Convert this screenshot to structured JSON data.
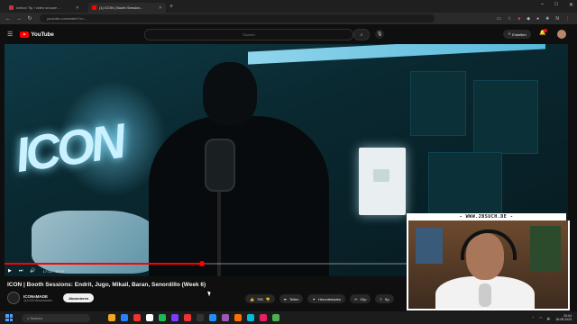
{
  "browser": {
    "tabs": [
      {
        "label": "Icebox Tip / video snooze ...",
        "favicon_color": "#c33"
      },
      {
        "label": "(1) ICON | Booth Session...",
        "favicon_color": "#ff0000"
      }
    ],
    "new_tab": "+",
    "url": "youtube.com/watch?v=...",
    "window_controls": [
      "–",
      "□",
      "✕"
    ]
  },
  "youtube": {
    "logo_text": "YouTube",
    "search_placeholder": "Suchen",
    "create_label": "Erstellen"
  },
  "player": {
    "time": "17:11 / 48:39",
    "progress": 0.35,
    "neon_text": "ICON"
  },
  "video": {
    "title": "ICON | Booth Sessions: Endrit, Jugo, Mikail, Baran, Senordillo (Week 6)",
    "channel_name": "ICONsMADE",
    "subscribers": "114.000 Abonnenten",
    "subscribe_label": "Abonnieren",
    "actions": [
      {
        "icon": "👍",
        "label": "759"
      },
      {
        "icon": "➦",
        "label": "Teilen"
      },
      {
        "icon": "✦",
        "label": "Herunterladen"
      },
      {
        "icon": "✂",
        "label": "Clip"
      },
      {
        "icon": "≡",
        "label": "Sp"
      }
    ]
  },
  "webcam": {
    "banner": "- WWW.2BSUCH.DE -"
  },
  "taskbar": {
    "search_placeholder": "Suchen",
    "app_colors": [
      "#f5a623",
      "#2d7ff9",
      "#e33",
      "#fff",
      "#1db954",
      "#7a3cff",
      "#e33",
      "#333",
      "#1e90ff",
      "#9b59b6",
      "#ff6f00",
      "#00bcd4",
      "#e91e63",
      "#4caf50"
    ],
    "clock_time": "20:04",
    "clock_date": "26.08.2023"
  }
}
